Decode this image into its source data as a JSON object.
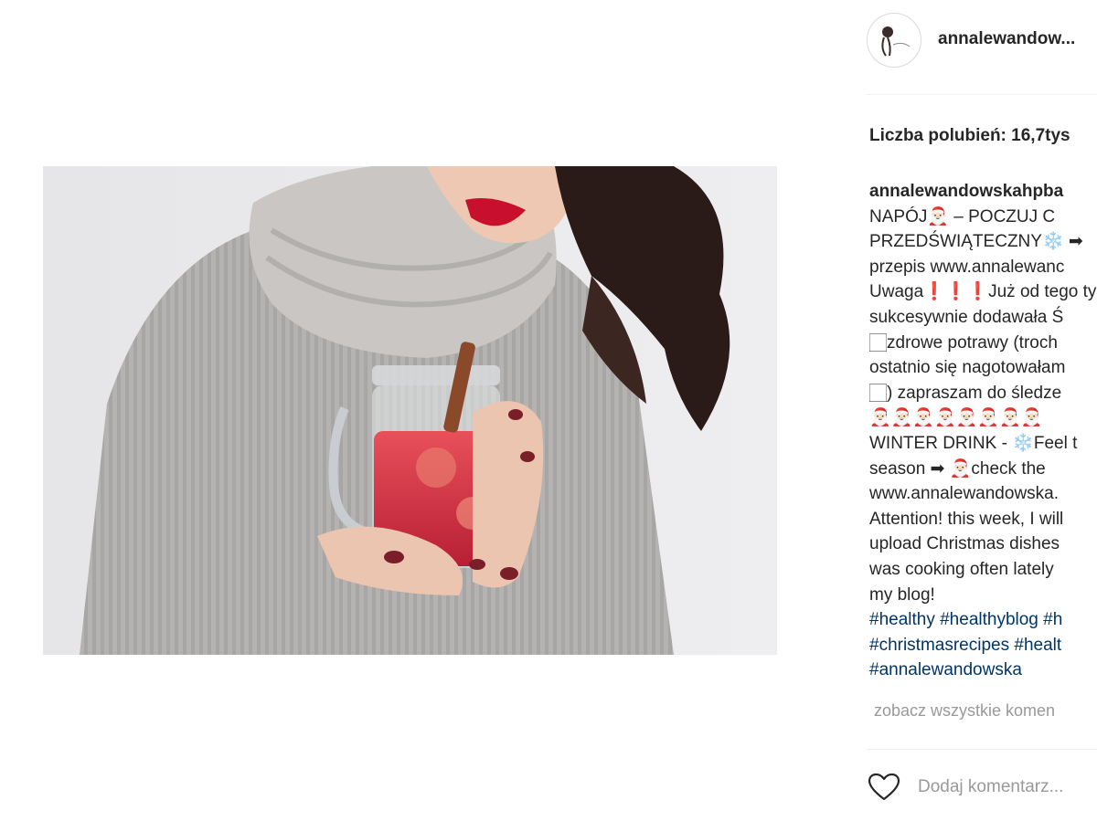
{
  "post": {
    "username": "annalewandow...",
    "likes_text": "Liczba polubień: 16,7tys",
    "caption_lines": [
      "annalewandowskahpba",
      "NAPÓJ🎅🏻 – POCZUJ C",
      "PRZEDŚWIĄTECZNY❄️ ➡",
      "przepis www.annalewanc",
      "Uwaga❗❗❗Już od tego ty",
      "sukcesywnie dodawała Ś",
      "🏻zdrowe potrawy (troch",
      "ostatnio się nagotowałam",
      "🏻) zapraszam do śledze",
      "🎅🏻🎅🏻🎅🏻🎅🏻🎅🏻🎅🏻🎅🏻🎅🏻",
      "WINTER DRINK - ❄️Feel t",
      "season ➡ 🎅🏻check the",
      "www.annalewandowska.",
      "Attention! this week, I will",
      "upload Christmas dishes",
      "was cooking often lately",
      "my blog!"
    ],
    "hashtag_lines": [
      "#healthy #healthyblog #h",
      "#christmasrecipes #healt",
      "#annalewandowska"
    ],
    "view_all_comments": "zobacz wszystkie komen",
    "comment_placeholder": "Dodaj komentarz...",
    "icons": {
      "like": "heart-outline-icon",
      "avatar": "profile-avatar"
    },
    "colors": {
      "hashtag": "#003569",
      "muted": "#999999",
      "text": "#262626"
    }
  }
}
